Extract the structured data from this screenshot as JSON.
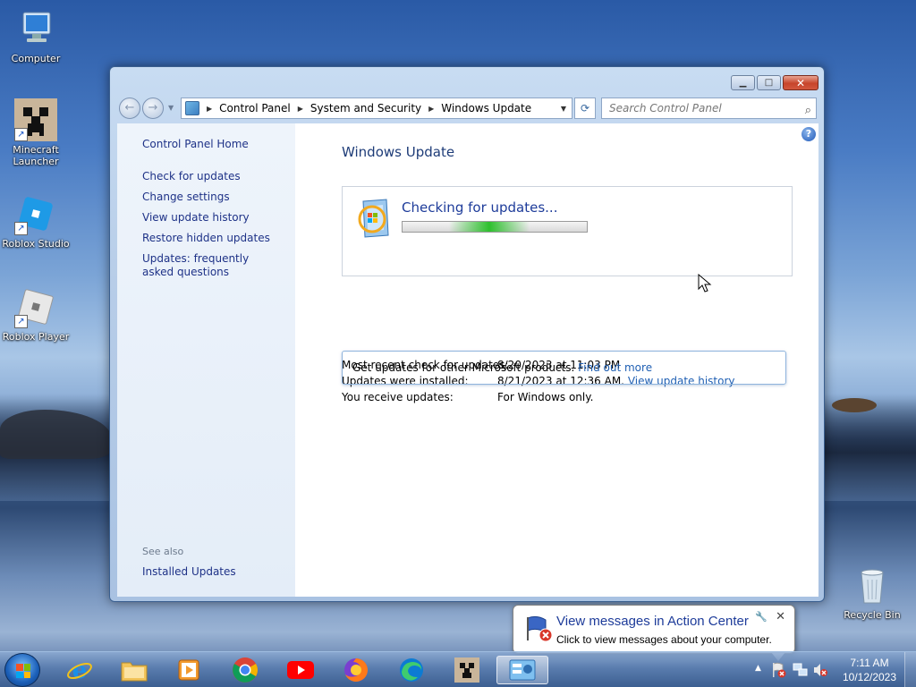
{
  "desktop": {
    "icons": [
      {
        "label": "Computer"
      },
      {
        "label": "Minecraft Launcher"
      },
      {
        "label": "Roblox Studio"
      },
      {
        "label": "Roblox Player"
      },
      {
        "label": "Recycle Bin"
      }
    ]
  },
  "window": {
    "caption": {
      "minimize": "▁",
      "maximize": "□",
      "close": "✕"
    },
    "nav": {
      "back": "←",
      "forward": "→"
    },
    "breadcrumb": [
      "Control Panel",
      "System and Security",
      "Windows Update"
    ],
    "search_placeholder": "Search Control Panel",
    "sidebar": {
      "home": "Control Panel Home",
      "links": [
        "Check for updates",
        "Change settings",
        "View update history",
        "Restore hidden updates",
        "Updates: frequently asked questions"
      ],
      "see_also": "See also",
      "installed_updates": "Installed Updates"
    },
    "main": {
      "title": "Windows Update",
      "status": "Checking for updates...",
      "progress_pct": 45,
      "info": [
        {
          "label": "Most recent check for updates:",
          "value": "8/20/2023 at 11:03 PM"
        },
        {
          "label": "Updates were installed:",
          "value": "8/21/2023 at 12:36 AM.",
          "link": "View update history"
        },
        {
          "label": "You receive updates:",
          "value": "For Windows only."
        }
      ],
      "get_updates_text": "Get updates for other Microsoft products.",
      "find_out_more": "Find out more"
    }
  },
  "notification": {
    "title": "View messages in Action Center",
    "body": "Click to view messages about your computer."
  },
  "taskbar": {
    "apps": [
      "internet-explorer",
      "file-explorer",
      "media-player",
      "chrome",
      "youtube",
      "firefox",
      "edge",
      "minecraft",
      "control-panel"
    ],
    "clock_time": "7:11 AM",
    "clock_date": "10/12/2023"
  }
}
